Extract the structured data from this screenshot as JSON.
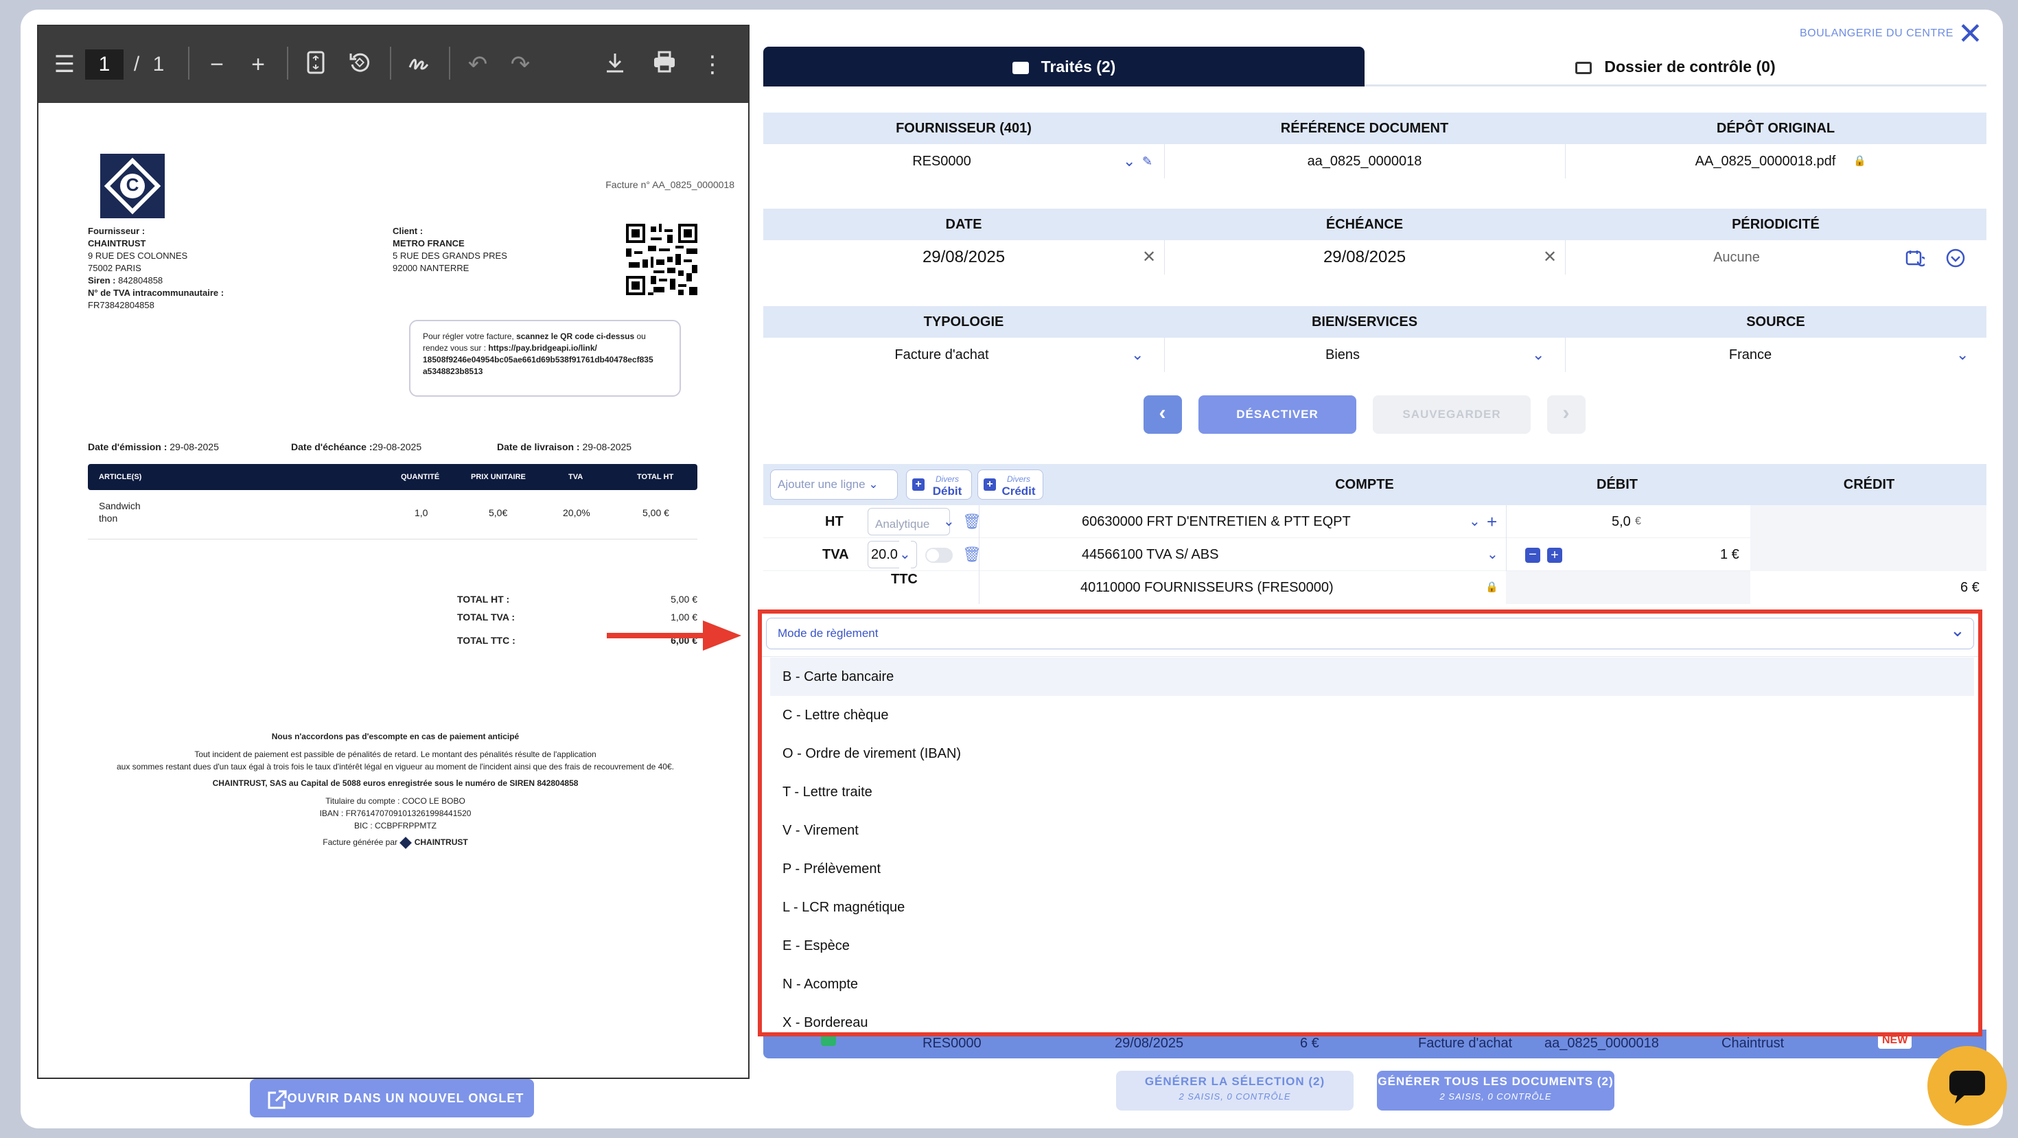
{
  "company": "BOULANGERIE DU CENTRE",
  "pdf": {
    "page_current": "1",
    "page_sep": "/",
    "page_total": "1",
    "invoice_number": "Facture n° AA_0825_0000018",
    "supplier_title": "Fournisseur :",
    "supplier_name": "CHAINTRUST",
    "supplier_addr1": "9 RUE DES COLONNES",
    "supplier_addr2": "75002 PARIS",
    "siren_label": "Siren :",
    "siren_value": "842804858",
    "tva_label": "N° de TVA intracommunautaire :",
    "tva_value": "FR73842804858",
    "client_title": "Client :",
    "client_name": "METRO FRANCE",
    "client_addr1": "5 RUE DES GRANDS PRES",
    "client_addr2": "92000 NANTERRE",
    "pay_text1": "Pour régler votre facture,",
    "pay_text1b": "scannez le QR code ci-dessus",
    "pay_text1c": "ou",
    "pay_text2": "rendez vous sur :",
    "pay_link1": "https://pay.bridgeapi.io/link/",
    "pay_link2": "18508f9246e04954bc05ae661d69b538f91761db40478ecf835",
    "pay_link3": "a5348823b8513",
    "emission_label": "Date d'émission :",
    "emission_value": "29-08-2025",
    "echeance_label": "Date d'échéance :",
    "echeance_value": "29-08-2025",
    "livraison_label": "Date de livraison :",
    "livraison_value": "29-08-2025",
    "table_headers": [
      "ARTICLE(S)",
      "QUANTITÉ",
      "PRIX UNITAIRE",
      "TVA",
      "TOTAL HT"
    ],
    "item_name1": "Sandwich",
    "item_name2": "thon",
    "item_qty": "1,0",
    "item_price": "5,0€",
    "item_tva": "20,0%",
    "item_total": "5,00 €",
    "total_ht_label": "TOTAL HT :",
    "total_ht": "5,00 €",
    "total_tva_label": "TOTAL TVA :",
    "total_tva": "1,00 €",
    "total_ttc_label": "TOTAL TTC :",
    "total_ttc": "6,00 €",
    "footer1": "Nous n'accordons pas d'escompte en cas de paiement anticipé",
    "footer2": "Tout incident de paiement est passible de pénalités de retard. Le montant des pénalités résulte de l'application",
    "footer3": "aux sommes restant dues d'un taux égal à trois fois le taux d'intérêt légal en vigueur au moment de l'incident ainsi que des frais de recouvrement de 40€.",
    "footer4": "CHAINTRUST, SAS au Capital de 5088 euros enregistrée sous le numéro de SIREN 842804858",
    "footer5": "Titulaire du compte : COCO LE BOBO",
    "footer6": "IBAN : FR7614707091013261998441520",
    "footer7": "BIC : CCBPFRPPMTZ",
    "footer8": "Facture générée par",
    "footer_brand": "CHAINTRUST",
    "logo_letter": "C"
  },
  "open_tab_label": "OUVRIR DANS UN NOUVEL ONGLET",
  "tabs": [
    {
      "label": "Traités (2)"
    },
    {
      "label": "Dossier de contrôle (0)"
    }
  ],
  "section1": {
    "headers": [
      "FOURNISSEUR (401)",
      "RÉFÉRENCE DOCUMENT",
      "DÉPÔT ORIGINAL"
    ],
    "supplier": "RES0000",
    "reference": "aa_0825_0000018",
    "original": "AA_0825_0000018.pdf"
  },
  "section2": {
    "headers": [
      "DATE",
      "ÉCHÉANCE",
      "PÉRIODICITÉ"
    ],
    "date": "29/08/2025",
    "echeance": "29/08/2025",
    "periodicite": "Aucune"
  },
  "section3": {
    "headers": [
      "TYPOLOGIE",
      "BIEN/SERVICES",
      "SOURCE"
    ],
    "typologie": "Facture d'achat",
    "bien": "Biens",
    "source": "France"
  },
  "actions": {
    "disable": "DÉSACTIVER",
    "save": "SAUVEGARDER"
  },
  "entries": {
    "add_line": "Ajouter une ligne",
    "divers": "Divers",
    "debit_btn": "Débit",
    "credit_btn": "Crédit",
    "col_compte": "COMPTE",
    "col_debit": "DÉBIT",
    "col_credit": "CRÉDIT",
    "ht_label": "HT",
    "analytique": "Analytique",
    "ht_account": "60630000 FRT D'ENTRETIEN & PTT EQPT",
    "ht_debit": "5,0",
    "euro": "€",
    "tva_label": "TVA",
    "tva_rate": "20.0",
    "tva_account": "44566100 TVA S/ ABS",
    "tva_debit": "1 €",
    "ttc_label": "TTC",
    "ttc_account": "40110000 FOURNISSEURS (FRES0000)",
    "ttc_credit": "6 €"
  },
  "payment": {
    "placeholder": "Mode de règlement",
    "options": [
      "B - Carte bancaire",
      "C - Lettre chèque",
      "O - Ordre de virement (IBAN)",
      "T - Lettre traite",
      "V - Virement",
      "P - Prélèvement",
      "L - LCR magnétique",
      "E - Espèce",
      "N - Acompte",
      "X - Bordereau"
    ]
  },
  "summary_row": {
    "supplier": "RES0000",
    "date": "29/08/2025",
    "amount": "6 €",
    "type": "Facture d'achat",
    "ref": "aa_0825_0000018",
    "source": "Chaintrust",
    "badge": "NEW"
  },
  "generate": {
    "selection": "GÉNÉRER LA SÉLECTION (2)",
    "selection_sub": "2 SAISIS, 0 CONTRÔLE",
    "all": "GÉNÉRER TOUS LES DOCUMENTS (2)",
    "all_sub": "2 SAISIS, 0 CONTRÔLE"
  },
  "colors": {
    "navy": "#0d1b3e",
    "accent": "#3a55c8",
    "header_bg": "#dfe8f7",
    "highlight": "#e63b2e",
    "chat": "#f2b233"
  }
}
